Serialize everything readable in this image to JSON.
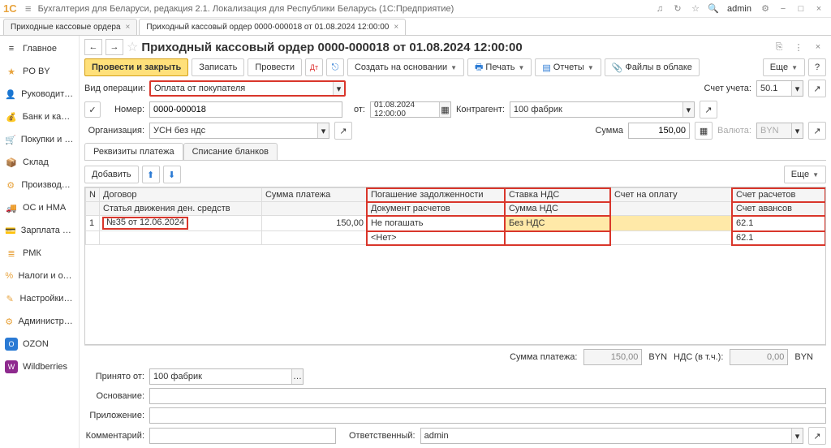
{
  "titlebar": {
    "logo": "1С",
    "title": "Бухгалтерия для Беларуси, редакция 2.1. Локализация для Республики Беларусь  (1С:Предприятие)",
    "user": "admin"
  },
  "tabs": [
    {
      "label": "Приходные кассовые ордера",
      "active": false
    },
    {
      "label": "Приходный кассовый ордер 0000-000018 от 01.08.2024 12:00:00",
      "active": true
    }
  ],
  "sidebar": [
    {
      "icon": "≡",
      "label": "Главное",
      "color": "#888"
    },
    {
      "icon": "★",
      "label": "PO BY",
      "color": "#e8a33d"
    },
    {
      "icon": "👤",
      "label": "Руководителю",
      "color": "#e8a33d"
    },
    {
      "icon": "💰",
      "label": "Банк и касса",
      "color": "#e8a33d"
    },
    {
      "icon": "🛒",
      "label": "Покупки и продажи",
      "color": "#e8a33d"
    },
    {
      "icon": "📦",
      "label": "Склад",
      "color": "#e8a33d"
    },
    {
      "icon": "⚙",
      "label": "Производство",
      "color": "#e8a33d"
    },
    {
      "icon": "🚚",
      "label": "ОС и НМА",
      "color": "#e8a33d"
    },
    {
      "icon": "💳",
      "label": "Зарплата и кадры",
      "color": "#e8a33d"
    },
    {
      "icon": "≣",
      "label": "РМК",
      "color": "#e8a33d"
    },
    {
      "icon": "%",
      "label": "Налоги и отчетность",
      "color": "#e8a33d"
    },
    {
      "icon": "✎",
      "label": "Настройки учета",
      "color": "#e8a33d"
    },
    {
      "icon": "⚙",
      "label": "Администрирование",
      "color": "#e8a33d"
    },
    {
      "icon": "○",
      "label": "OZON",
      "color": "#2a7ad4"
    },
    {
      "icon": "W",
      "label": "Wildberries",
      "color": "#8e2a8e"
    }
  ],
  "doc": {
    "title": "Приходный кассовый ордер 0000-000018 от 01.08.2024 12:00:00",
    "toolbar": {
      "save": "Провести и закрыть",
      "write": "Записать",
      "post": "Провести",
      "create": "Создать на основании",
      "print": "Печать",
      "reports": "Отчеты",
      "cloud": "Файлы в облаке",
      "more": "Еще"
    },
    "form": {
      "op_lbl": "Вид операции:",
      "op_val": "Оплата от покупателя",
      "acc_lbl": "Счет учета:",
      "acc_val": "50.1",
      "num_lbl": "Номер:",
      "num_val": "0000-000018",
      "from_lbl": "от:",
      "from_val": "01.08.2024 12:00:00",
      "ctr_lbl": "Контрагент:",
      "ctr_val": "100 фабрик",
      "org_lbl": "Организация:",
      "org_val": "УСН без ндс",
      "sum_lbl": "Сумма",
      "sum_val": "150,00",
      "cur_lbl": "Валюта:",
      "cur_val": "BYN"
    },
    "tabs": [
      "Реквизиты платежа",
      "Списание бланков"
    ],
    "tb_toolbar": {
      "add": "Добавить"
    },
    "grid_more": "Еще",
    "grid": {
      "head": [
        [
          "N",
          "Договор",
          "Сумма платежа",
          "Погашение задолженности",
          "Ставка НДС",
          "Счет на оплату",
          "Счет расчетов"
        ],
        [
          "",
          "Статья движения ден. средств",
          "",
          "Документ расчетов",
          "Сумма НДС",
          "",
          "Счет авансов"
        ]
      ],
      "row": {
        "n": "1",
        "contract": "№35 от 12.06.2024",
        "sum": "150,00",
        "pog": "Не погашать",
        "doc": "<Нет>",
        "vat": "Без НДС",
        "acc1": "62.1",
        "acc2": "62.1"
      }
    },
    "totals": {
      "sum_lbl": "Сумма платежа:",
      "sum_val": "150,00",
      "sum_cur": "BYN",
      "vat_lbl": "НДС (в т.ч.):",
      "vat_val": "0,00",
      "vat_cur": "BYN"
    },
    "footer": {
      "from_lbl": "Принято от:",
      "from_val": "100 фабрик",
      "base_lbl": "Основание:",
      "att_lbl": "Приложение:",
      "comm_lbl": "Комментарий:",
      "resp_lbl": "Ответственный:",
      "resp_val": "admin"
    }
  }
}
